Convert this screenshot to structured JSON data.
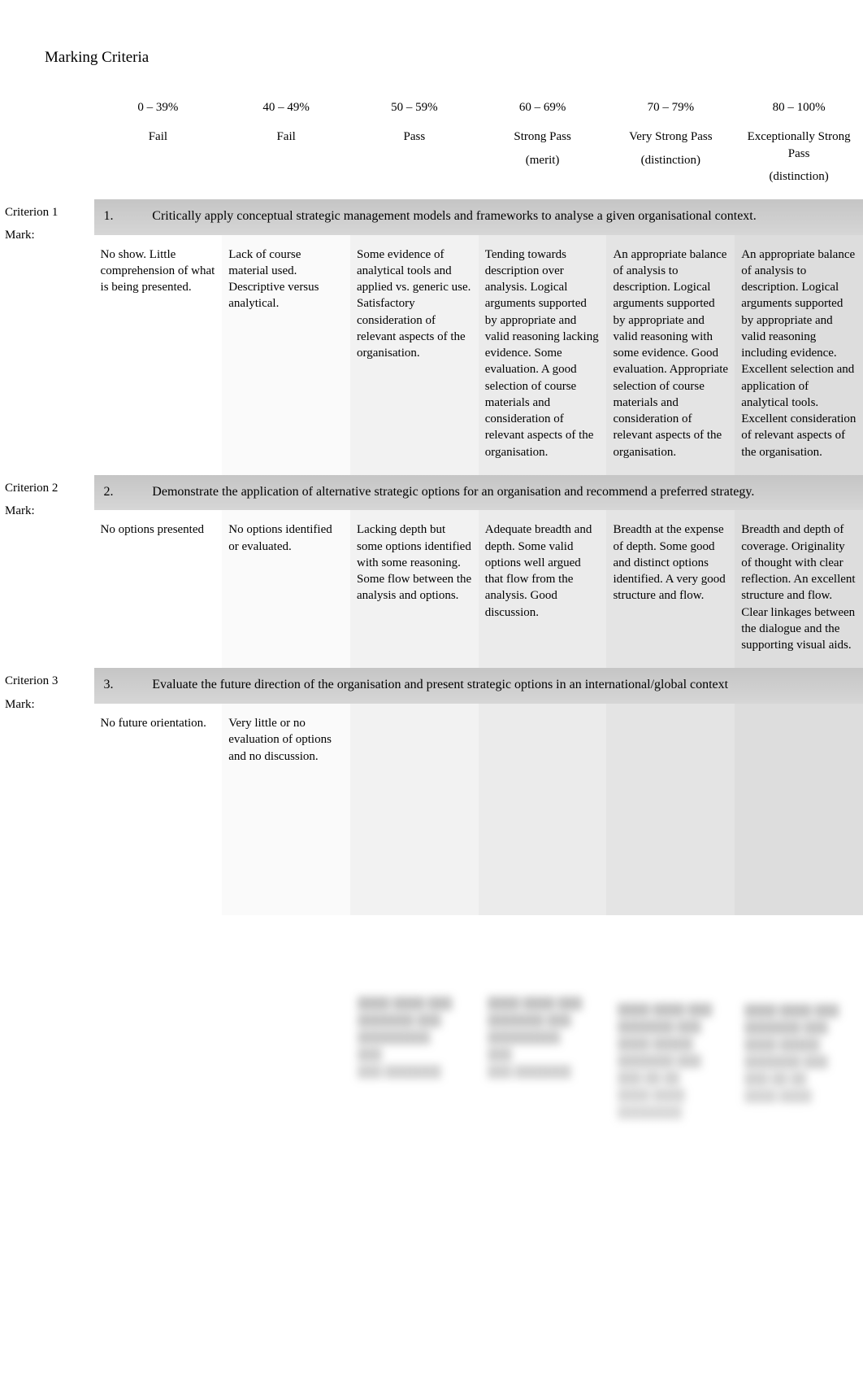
{
  "title": "Marking Criteria",
  "bands": [
    {
      "range": "0 – 39%",
      "grade": "Fail",
      "note": ""
    },
    {
      "range": "40  – 49%",
      "grade": "Fail",
      "note": ""
    },
    {
      "range": "50  – 59%",
      "grade": "Pass",
      "note": ""
    },
    {
      "range": "60  – 69%",
      "grade": "Strong Pass",
      "note": "(merit)"
    },
    {
      "range": "70  – 79%",
      "grade": "Very Strong Pass",
      "note": "(distinction)"
    },
    {
      "range": "80  – 100%",
      "grade": "Exceptionally Strong Pass",
      "note": "(distinction)"
    }
  ],
  "criteria": [
    {
      "label": "Criterion 1",
      "mark_label": "Mark:",
      "number": "1.",
      "text": "Critically apply conceptual strategic management models and frameworks to analyse a given organisational context.",
      "cells": [
        "No show.   Little comprehension of what is being presented.",
        "Lack of course material used. Descriptive versus analytical.",
        "Some evidence of analytical tools and applied vs. generic use. Satisfactory consideration of relevant aspects of the organisation.",
        "Tending towards description over analysis.  Logical arguments supported by appropriate and valid reasoning lacking evidence. Some evaluation. A good selection of course materials and consideration of relevant aspects of the organisation.",
        "An appropriate balance of analysis to description. Logical arguments supported by appropriate and valid reasoning with some evidence. Good evaluation. Appropriate selection of course materials and consideration of relevant aspects of the organisation.",
        "An appropriate balance of analysis to description. Logical arguments supported by appropriate and valid reasoning including evidence. Excellent selection and application of analytical tools. Excellent consideration of relevant aspects of the organisation."
      ]
    },
    {
      "label": "Criterion 2",
      "mark_label": "Mark:",
      "number": "2.",
      "text": "Demonstrate the application of alternative strategic options for an organisation and recommend a preferred strategy.",
      "cells": [
        "No options presented",
        "No options identified or evaluated.",
        "Lacking depth but some options identified with some reasoning. Some flow between the analysis and options.",
        "Adequate breadth and depth.   Some valid options well argued that flow from the analysis. Good discussion.",
        "Breadth at the expense of depth. Some good and distinct options identified. A very good structure and flow.",
        "Breadth and depth of coverage. Originality of thought with clear reflection. An excellent structure and flow. Clear linkages between the dialogue and the supporting visual aids."
      ]
    },
    {
      "label": "Criterion 3",
      "mark_label": "Mark:",
      "number": "3.",
      "text": "Evaluate the future direction of the organisation and present strategic options in an international/global context",
      "cells": [
        "No future orientation.",
        "Very little or no evaluation of options and no discussion.",
        "",
        "",
        "",
        ""
      ]
    }
  ]
}
